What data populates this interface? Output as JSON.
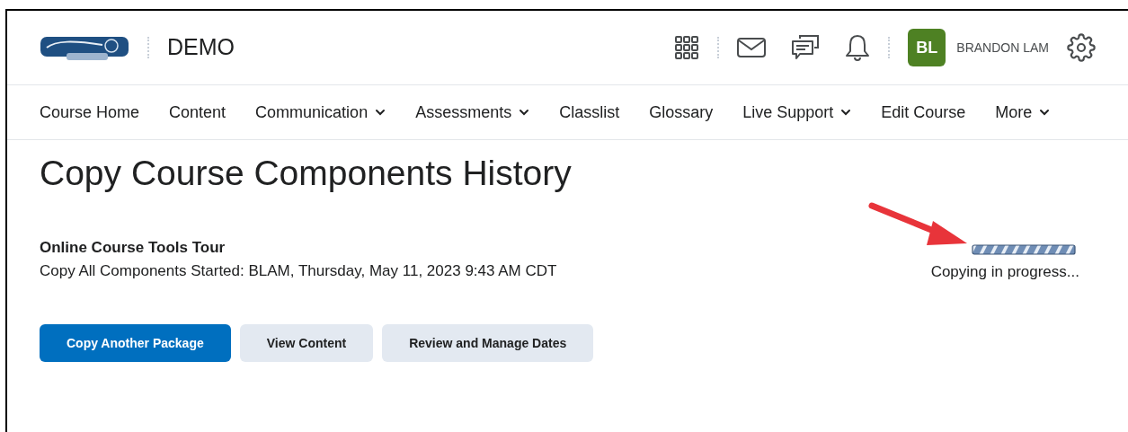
{
  "header": {
    "course": "DEMO",
    "avatar_initials": "BL",
    "user_name": "BRANDON LAM"
  },
  "nav": [
    {
      "label": "Course Home",
      "dropdown": false
    },
    {
      "label": "Content",
      "dropdown": false
    },
    {
      "label": "Communication",
      "dropdown": true
    },
    {
      "label": "Assessments",
      "dropdown": true
    },
    {
      "label": "Classlist",
      "dropdown": false
    },
    {
      "label": "Glossary",
      "dropdown": false
    },
    {
      "label": "Live Support",
      "dropdown": true
    },
    {
      "label": "Edit Course",
      "dropdown": false
    },
    {
      "label": "More",
      "dropdown": true
    }
  ],
  "page_title": "Copy Course Components History",
  "job": {
    "title": "Online Course Tools Tour",
    "detail": "Copy All Components Started: BLAM, Thursday, May 11, 2023 9:43 AM CDT",
    "status": "Copying in progress...",
    "level": 1
  },
  "buttons": [
    {
      "label": "Copy Another Package",
      "primary": true
    },
    {
      "label": "View Content",
      "primary": false
    },
    {
      "label": "Review and Manage Dates",
      "primary": false
    }
  ]
}
